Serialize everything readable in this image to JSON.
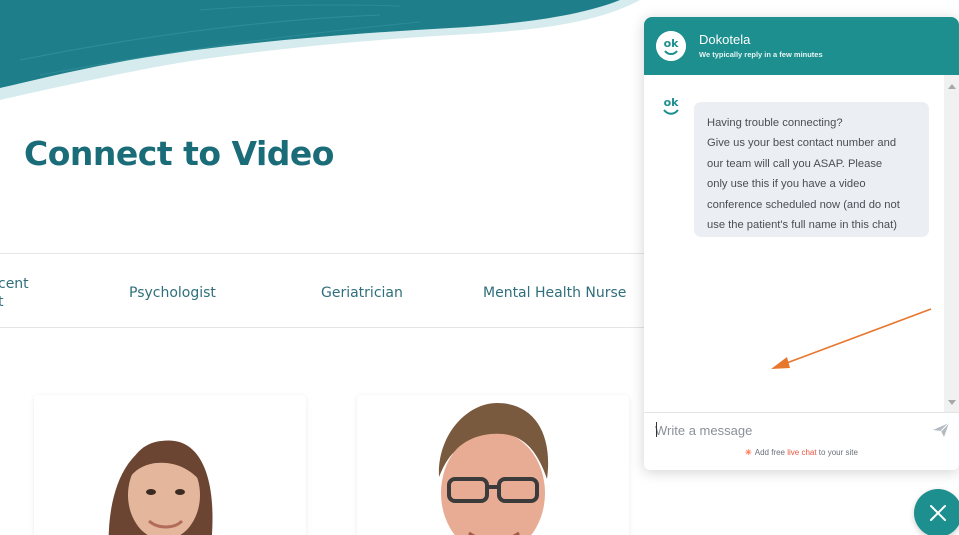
{
  "page": {
    "title": "Connect to Video",
    "filters": {
      "partial_label": "cent\nt",
      "items": [
        "Psychologist",
        "Geriatrician",
        "Mental Health Nurse"
      ]
    }
  },
  "chat": {
    "brand": "Dokotela",
    "status": "We typically reply in a few minutes",
    "logo_text": "ok",
    "message_lines": [
      "Having trouble connecting?",
      "Give us your best contact number and",
      "our team will call you ASAP. Please",
      "only use this if you have a video",
      "conference scheduled now (and do not",
      "use the patient's full name in this chat)"
    ],
    "composer_placeholder": "Write a message",
    "powered_prefix": "Add free ",
    "powered_link": "live chat",
    "powered_suffix": " to your site",
    "accent_color": "#1c8f8e"
  },
  "icons": {
    "send": "send-icon",
    "close": "close-icon",
    "hubspot": "hubspot-icon"
  },
  "colors": {
    "title": "#1b6c79",
    "filter_text": "#2f6f7b",
    "annotation_arrow": "#e8772e"
  }
}
